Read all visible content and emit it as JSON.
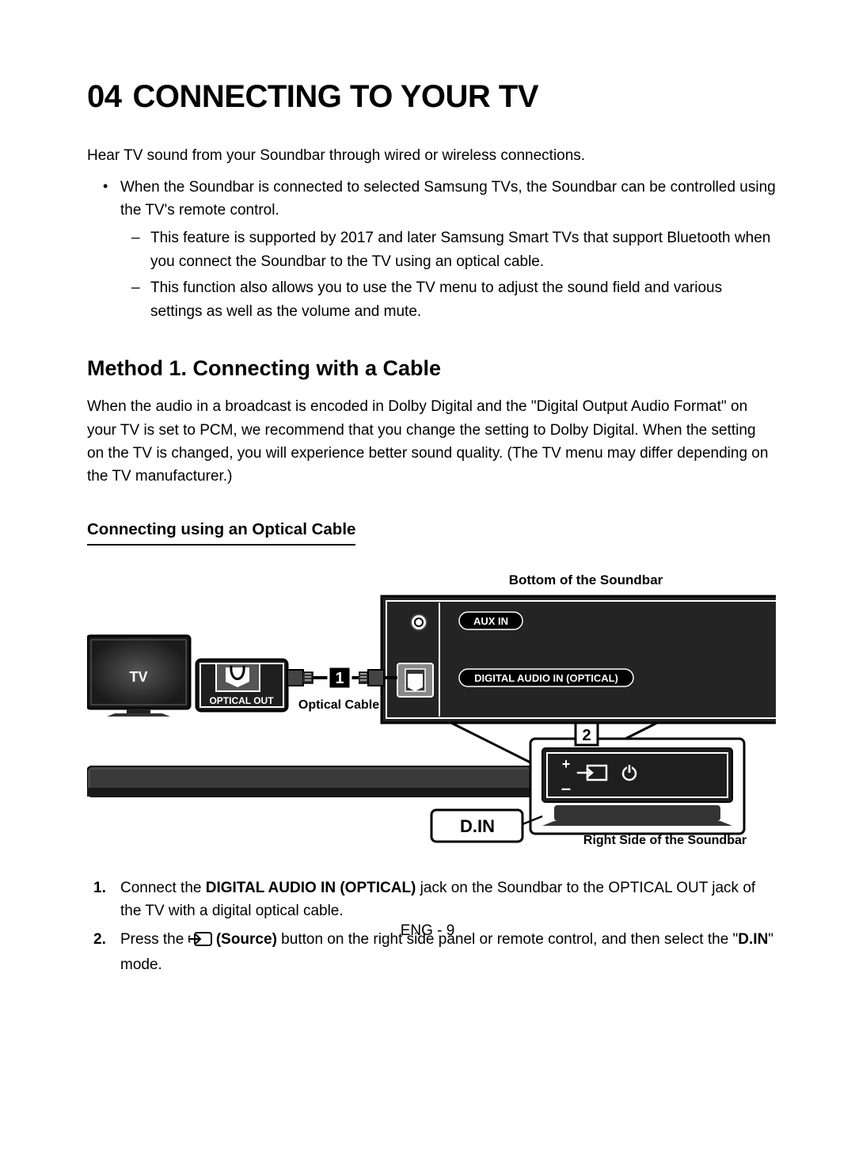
{
  "section": {
    "number": "04",
    "title": "CONNECTING TO YOUR TV"
  },
  "intro": "Hear TV sound from your Soundbar through wired or wireless connections.",
  "bullet": {
    "main": "When the Soundbar is connected to selected Samsung TVs, the Soundbar can be controlled using the TV's remote control.",
    "sub1": "This feature is supported by 2017 and later Samsung Smart TVs that support Bluetooth when you connect the Soundbar to the TV using an optical cable.",
    "sub2": "This function also allows you to use the TV menu to adjust the sound field and various settings as well as the volume and mute."
  },
  "method": {
    "title": "Method 1. Connecting with a Cable",
    "body": "When the audio in a broadcast is encoded in Dolby Digital and the \"Digital Output Audio Format\" on your TV is set to PCM, we recommend that you change the setting to Dolby Digital. When the setting on the TV is changed, you will experience better sound quality. (The TV menu may differ depending on the TV manufacturer.)"
  },
  "subsection": {
    "title": "Connecting using an Optical Cable"
  },
  "diagram": {
    "top_label": "Bottom of the Soundbar",
    "tv_label": "TV",
    "optical_out": "OPTICAL OUT",
    "optical_cable": "Optical Cable",
    "aux_in": "AUX IN",
    "digital_audio_in": "DIGITAL AUDIO IN (OPTICAL)",
    "din": "D.IN",
    "right_side": "Right Side of the Soundbar",
    "callout1": "1",
    "callout2": "2"
  },
  "steps": {
    "s1_num": "1.",
    "s1_pre": "Connect the ",
    "s1_bold": "DIGITAL AUDIO IN (OPTICAL)",
    "s1_post": " jack on the Soundbar to the OPTICAL OUT jack of the TV with a digital optical cable.",
    "s2_num": "2.",
    "s2_pre": "Press the ",
    "s2_bold": " (Source)",
    "s2_mid": " button on the right side panel or remote control, and then select the \"",
    "s2_din": "D.IN",
    "s2_post": "\" mode."
  },
  "footer": "ENG - 9"
}
